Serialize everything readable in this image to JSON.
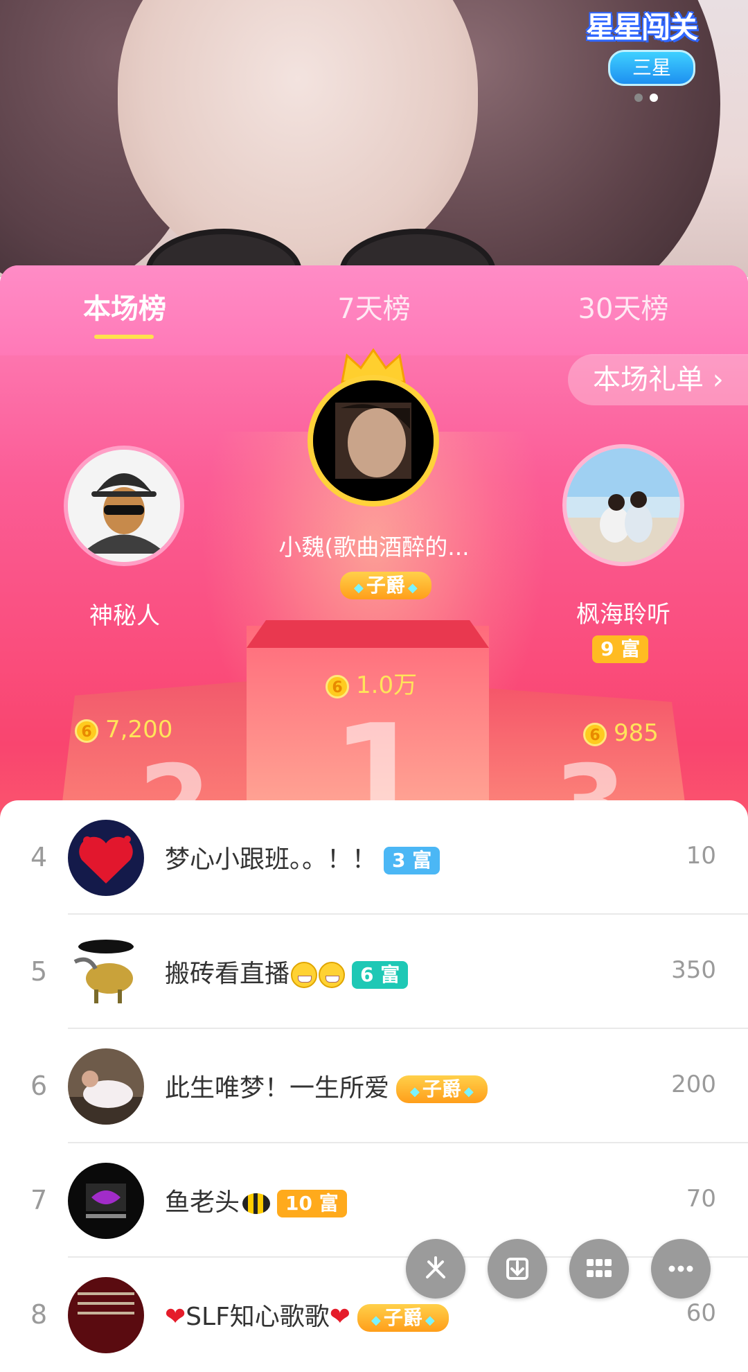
{
  "event": {
    "logo_text": "星星闯关",
    "level_label": "三星",
    "page_indicator": {
      "count": 2,
      "active": 1
    }
  },
  "tabs": [
    {
      "label": "本场榜",
      "active": true
    },
    {
      "label": "7天榜",
      "active": false
    },
    {
      "label": "30天榜",
      "active": false
    }
  ],
  "gift_list_button": "本场礼单 ›",
  "podium": {
    "first": {
      "rank": "1",
      "name": "小魏(歌曲酒醉的...",
      "badge": "子爵",
      "score": "1.0万"
    },
    "second": {
      "rank": "2",
      "name": "神秘人",
      "score": "7,200"
    },
    "third": {
      "rank": "3",
      "name": "枫海聆听",
      "badge": "9 富",
      "score": "985"
    }
  },
  "coin_symbol": "6",
  "list": [
    {
      "rank": "4",
      "name": "梦心小跟班。。！！",
      "badge": "3 富",
      "badge_color": "#4bb7f5",
      "score": "10"
    },
    {
      "rank": "5",
      "name": "搬砖看直播",
      "badge": "6 富",
      "badge_color": "#1ec8b5",
      "score": "350"
    },
    {
      "rank": "6",
      "name": "此生唯梦！一生所爱",
      "badge": "子爵",
      "score": "200"
    },
    {
      "rank": "7",
      "name": "鱼老头",
      "badge": "10 富",
      "badge_color": "#ffaa1c",
      "score": "70"
    },
    {
      "rank": "8",
      "name": "SLF知心歌歌",
      "badge": "子爵",
      "score": "60"
    }
  ],
  "floating_actions": [
    "share-icon",
    "download-icon",
    "grid-icon",
    "more-icon"
  ],
  "colors": {
    "panel_pink": "#fb5d96",
    "tab_indicator": "#ffe14c",
    "coin_gold": "#ffcb1f",
    "score_gold": "#ffe45a"
  }
}
